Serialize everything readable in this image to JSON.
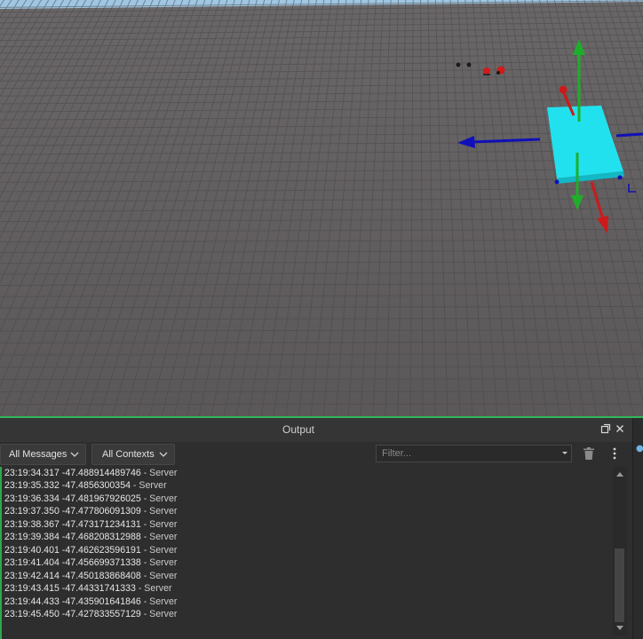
{
  "viewport": {
    "name": "3d-viewport",
    "colors": {
      "baseplate": "#5e5b5c",
      "part": "#22e1ee",
      "move_x": "#1010b8",
      "move_y": "#1fae2a",
      "move_z": "#cc1a1a",
      "sky": "#9fc7e3"
    }
  },
  "output": {
    "title": "Output",
    "message_filter": "All Messages",
    "context_filter": "All Contexts",
    "filter_placeholder": "Filter...",
    "icons": [
      "undock-icon",
      "close-icon",
      "chevron-down-icon",
      "trash-icon",
      "more-options-icon"
    ],
    "log": [
      {
        "time": "23:19:34.317",
        "value": "-47.488914489746",
        "source": "Server"
      },
      {
        "time": "23:19:35.332",
        "value": "-47.4856300354",
        "source": "Server"
      },
      {
        "time": "23:19:36.334",
        "value": "-47.481967926025",
        "source": "Server"
      },
      {
        "time": "23:19:37.350",
        "value": "-47.477806091309",
        "source": "Server"
      },
      {
        "time": "23:19:38.367",
        "value": "-47.473171234131",
        "source": "Server"
      },
      {
        "time": "23:19:39.384",
        "value": "-47.468208312988",
        "source": "Server"
      },
      {
        "time": "23:19:40.401",
        "value": "-47.462623596191",
        "source": "Server"
      },
      {
        "time": "23:19:41.404",
        "value": "-47.456699371338",
        "source": "Server"
      },
      {
        "time": "23:19:42.414",
        "value": "-47.450183868408",
        "source": "Server"
      },
      {
        "time": "23:19:43.415",
        "value": "-47.44331741333",
        "source": "Server"
      },
      {
        "time": "23:19:44.433",
        "value": "-47.435901641846",
        "source": "Server"
      },
      {
        "time": "23:19:45.450",
        "value": "-47.427833557129",
        "source": "Server"
      }
    ],
    "separator": " - ",
    "accent": "#2ea84f"
  }
}
